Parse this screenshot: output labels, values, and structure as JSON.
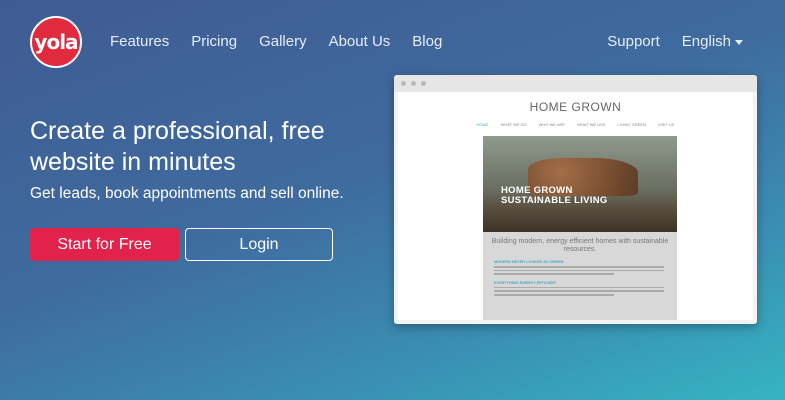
{
  "brand": {
    "logo_text": "yola",
    "color": "#e12a3e"
  },
  "nav": {
    "items": [
      "Features",
      "Pricing",
      "Gallery",
      "About Us",
      "Blog"
    ],
    "support": "Support",
    "language": "English"
  },
  "hero": {
    "headline": "Create a professional, free website in minutes",
    "subheadline": "Get leads, book appointments and sell online.",
    "start_button": "Start for Free",
    "login_button": "Login",
    "accent_color": "#e1224b"
  },
  "preview": {
    "site_title": "HOME GROWN",
    "site_nav": [
      "HOME",
      "WHAT WE DO",
      "WHO WE ARE",
      "WHAT WE USE",
      "LIVING GREEN",
      "VISIT US"
    ],
    "hero_line1": "HOME GROWN",
    "hero_line2": "SUSTAINABLE LIVING",
    "tagline": "Building modern, energy efficient homes with sustainable resources.",
    "heading1": "MODERN NEVER LOOKED SO GREEN",
    "heading2": "EVERYTHING ENERGY EFFICIENT"
  }
}
